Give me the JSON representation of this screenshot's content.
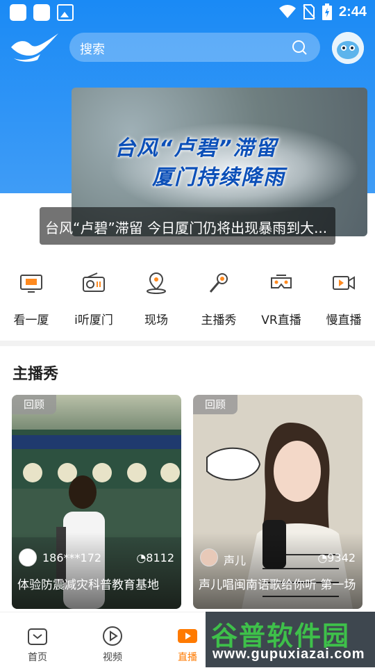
{
  "status_bar": {
    "time": "2:44"
  },
  "header": {
    "search_placeholder": "搜索"
  },
  "banner": {
    "overlay_line1": "台风“卢碧”滞留",
    "overlay_line2": "厦门持续降雨",
    "caption": "台风“卢碧”滞留 今日厦门仍将出现暴雨到大..."
  },
  "categories": [
    {
      "label": "看一厦",
      "icon": "tv-icon"
    },
    {
      "label": "i听厦门",
      "icon": "radio-icon"
    },
    {
      "label": "现场",
      "icon": "location-pin-icon"
    },
    {
      "label": "主播秀",
      "icon": "microphone-icon"
    },
    {
      "label": "VR直播",
      "icon": "vr-goggles-icon"
    },
    {
      "label": "慢直播",
      "icon": "video-camera-icon"
    }
  ],
  "section": {
    "title": "主播秀"
  },
  "cards": [
    {
      "tag": "回顾",
      "user": "186***172",
      "views": "8112",
      "title": "体验防震减灾科普教育基地"
    },
    {
      "tag": "回顾",
      "user": "声儿",
      "views": "9342",
      "title": "声儿唱闽南语歌给你听 第一场"
    }
  ],
  "tabbar": [
    {
      "label": "首页",
      "icon": "home-icon"
    },
    {
      "label": "视频",
      "icon": "play-circle-icon"
    },
    {
      "label": "直播",
      "icon": "live-play-icon"
    }
  ],
  "watermark": {
    "line1": "谷普软件园",
    "line2": "www.gupuxiazai.com"
  },
  "colors": {
    "primary_blue": "#1a8af5",
    "active_orange": "#ff7a00"
  }
}
